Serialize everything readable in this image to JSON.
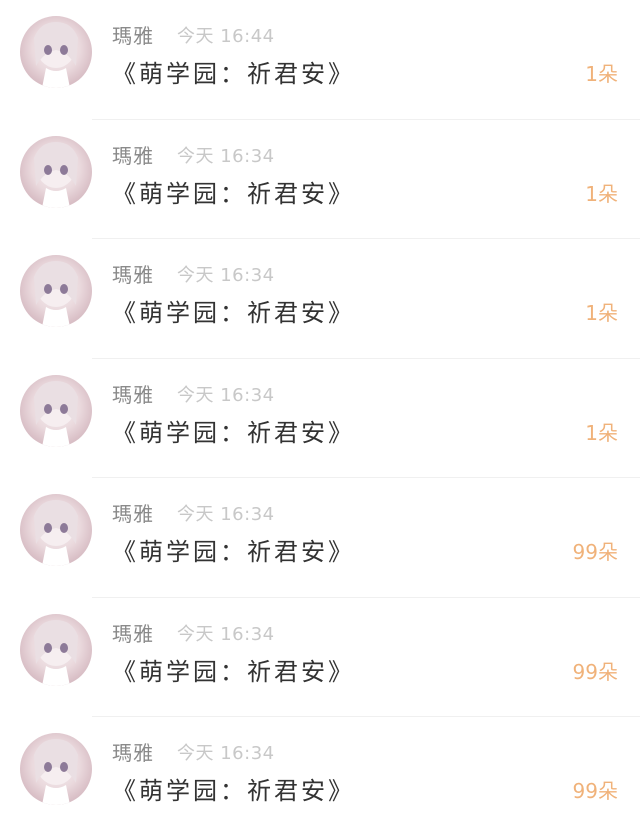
{
  "messages": [
    {
      "name": "瑪雅",
      "time": "今天 16:44",
      "text": "《萌学园：祈君安》",
      "count": "1朵",
      "avatar": "avatar-icon"
    },
    {
      "name": "瑪雅",
      "time": "今天 16:34",
      "text": "《萌学园：祈君安》",
      "count": "1朵",
      "avatar": "avatar-icon"
    },
    {
      "name": "瑪雅",
      "time": "今天 16:34",
      "text": "《萌学园：祈君安》",
      "count": "1朵",
      "avatar": "avatar-icon"
    },
    {
      "name": "瑪雅",
      "time": "今天 16:34",
      "text": "《萌学园：祈君安》",
      "count": "1朵",
      "avatar": "avatar-icon"
    },
    {
      "name": "瑪雅",
      "time": "今天 16:34",
      "text": "《萌学园：祈君安》",
      "count": "99朵",
      "avatar": "avatar-icon"
    },
    {
      "name": "瑪雅",
      "time": "今天 16:34",
      "text": "《萌学园：祈君安》",
      "count": "99朵",
      "avatar": "avatar-icon"
    },
    {
      "name": "瑪雅",
      "time": "今天 16:34",
      "text": "《萌学园：祈君安》",
      "count": "99朵",
      "avatar": "avatar-icon"
    }
  ],
  "colors": {
    "count": "#f0b27a",
    "name": "#8a8a8a",
    "time": "#c8c8c8",
    "text": "#333333"
  }
}
